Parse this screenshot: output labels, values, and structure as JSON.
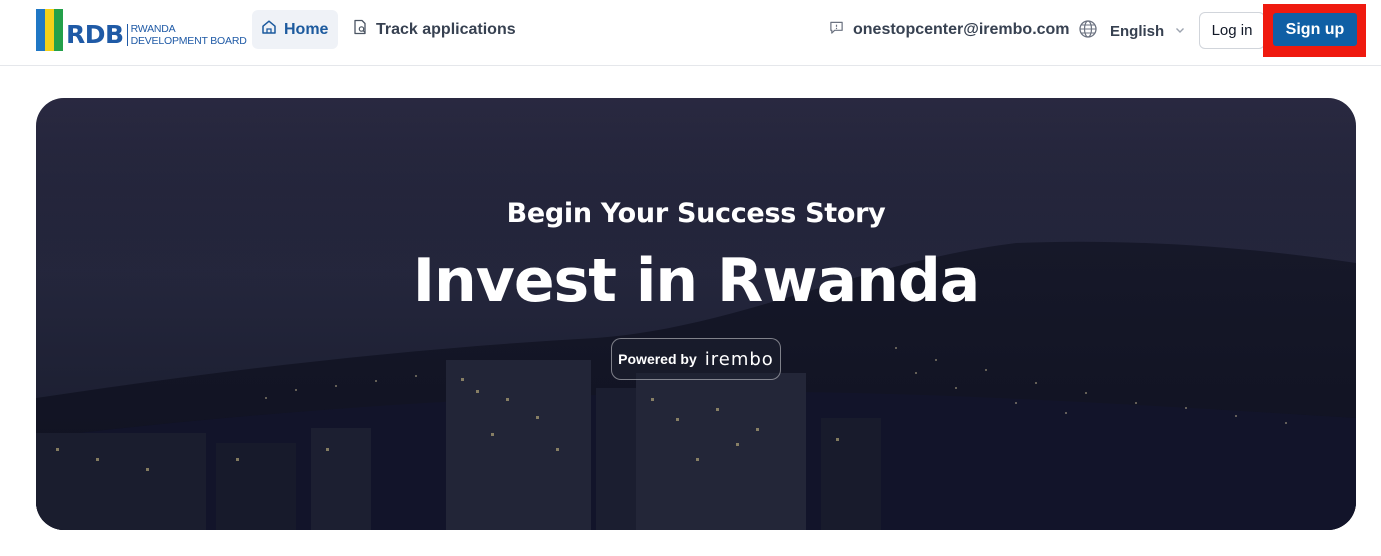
{
  "header": {
    "logo": {
      "abbr": "RDB",
      "line1": "RWANDA",
      "line2": "DEVELOPMENT BOARD",
      "flag_colors": [
        "#1f77c5",
        "#f3d11a",
        "#23a04a"
      ]
    },
    "nav": {
      "home_label": "Home",
      "home_icon": "home-icon",
      "track_label": "Track applications",
      "track_icon": "document-search-icon"
    },
    "contact": {
      "email": "onestopcenter@irembo.com",
      "icon": "chat-icon"
    },
    "language": {
      "selected": "English",
      "icon": "globe-icon"
    },
    "login_label": "Log in",
    "signup_label": "Sign up"
  },
  "hero": {
    "subtitle": "Begin Your Success Story",
    "title": "Invest in Rwanda",
    "powered_by": {
      "label": "Powered by",
      "brand": "irembo"
    }
  },
  "colors": {
    "primary": "#0f5fa5",
    "nav_active": "#1c5a9e",
    "highlight": "#ef1a0f"
  }
}
